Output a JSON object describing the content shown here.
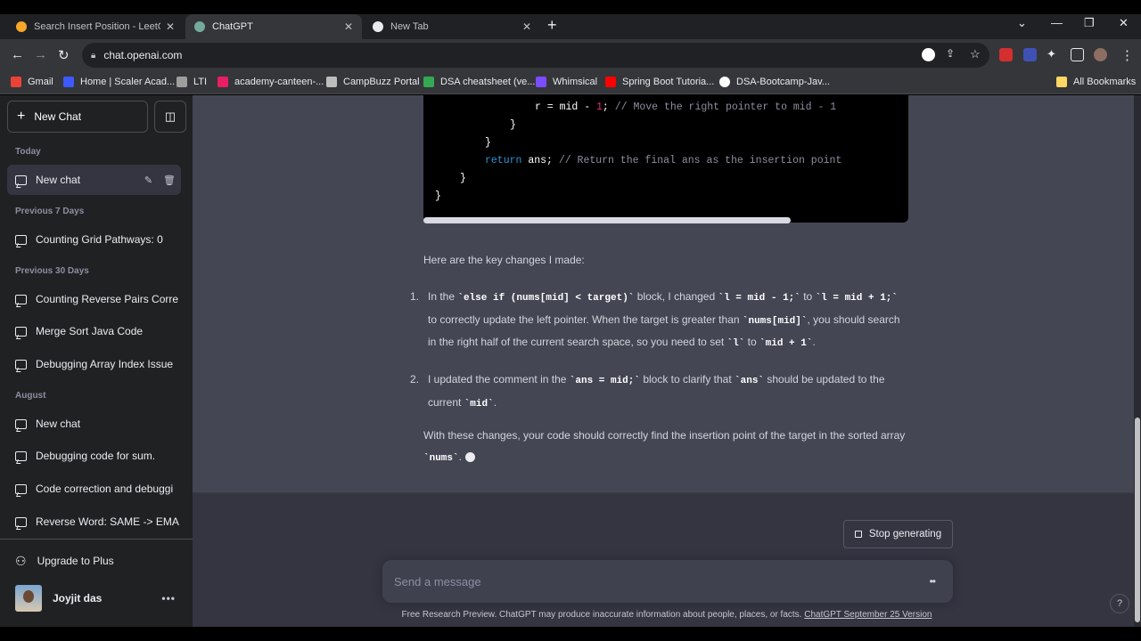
{
  "browser": {
    "tabs": [
      {
        "title": "Search Insert Position - LeetCod",
        "active": false
      },
      {
        "title": "ChatGPT",
        "active": true
      },
      {
        "title": "New Tab",
        "active": false
      }
    ],
    "url": "chat.openai.com",
    "bookmarks": [
      "Gmail",
      "Home | Scaler Acad...",
      "LTI",
      "academy-canteen-...",
      "CampBuzz Portal",
      "DSA cheatsheet (ve...",
      "Whimsical",
      "Spring Boot Tutoria...",
      "DSA-Bootcamp-Jav..."
    ],
    "all_bookmarks": "All Bookmarks"
  },
  "sidebar": {
    "new_chat": "New Chat",
    "sections": [
      {
        "label": "Today",
        "items": [
          {
            "label": "New chat",
            "active": true
          }
        ]
      },
      {
        "label": "Previous 7 Days",
        "items": [
          {
            "label": "Counting Grid Pathways: 0"
          }
        ]
      },
      {
        "label": "Previous 30 Days",
        "items": [
          {
            "label": "Counting Reverse Pairs Corre"
          },
          {
            "label": "Merge Sort Java Code"
          },
          {
            "label": "Debugging Array Index Issue"
          }
        ]
      },
      {
        "label": "August",
        "items": [
          {
            "label": "New chat"
          },
          {
            "label": "Debugging code for sum."
          },
          {
            "label": "Code correction and debuggi"
          },
          {
            "label": "Reverse Word: SAME -> EMA"
          }
        ]
      }
    ],
    "upgrade": "Upgrade to Plus",
    "user": "Joyjit das"
  },
  "code": {
    "line1a": "r = mid - ",
    "line1b": "1",
    "line1c": "; ",
    "line1comment": "// Move the right pointer to mid - 1",
    "line2": "}",
    "line3": "}",
    "line4kw": "return",
    "line4a": " ans; ",
    "line4comment": "// Return the final ans as the insertion point",
    "line5": "}",
    "line6": "}"
  },
  "message": {
    "intro": "Here are the key changes I made:",
    "item1": {
      "num": "1.",
      "t1": "In the ",
      "c1": "`else if (nums[mid] < target)`",
      "t2": " block, I changed ",
      "c2": "`l = mid - 1;`",
      "t3": " to ",
      "c3": "`l = mid + 1;`",
      "t4": " to correctly update the left pointer. When the target is greater than ",
      "c4": "`nums[mid]`",
      "t5": ", you should search in the right half of the current search space, so you need to set ",
      "c5": "`l`",
      "t6": " to ",
      "c6": "`mid + 1`",
      "t7": "."
    },
    "item2": {
      "num": "2.",
      "t1": "I updated the comment in the ",
      "c1": "`ans = mid;`",
      "t2": " block to clarify that ",
      "c2": "`ans`",
      "t3": " should be updated to the current ",
      "c3": "`mid`",
      "t4": "."
    },
    "outro_a": "With these changes, your code should correctly find the insertion point of the target in the sorted array ",
    "outro_code": "`nums`",
    "outro_b": "."
  },
  "controls": {
    "stop": "Stop generating",
    "placeholder": "Send a message",
    "footnote": "Free Research Preview. ChatGPT may produce inaccurate information about people, places, or facts. ",
    "footnote_link": "ChatGPT September 25 Version",
    "help": "?"
  }
}
